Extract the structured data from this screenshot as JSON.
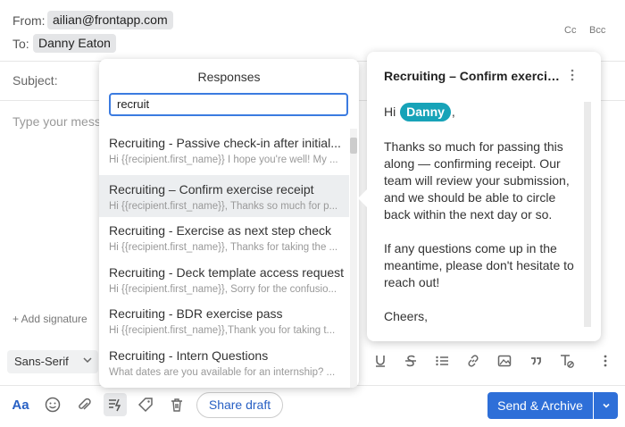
{
  "header": {
    "from_label": "From:",
    "from_value": "ailian@frontapp.com",
    "to_label": "To:",
    "to_value": "Danny Eaton",
    "cc": "Cc",
    "bcc": "Bcc",
    "subject_label": "Subject:",
    "body_placeholder": "Type your message..."
  },
  "add_signature": "+ Add signature",
  "format_bar": {
    "font": "Sans-Serif",
    "icons": [
      "underline-icon",
      "strikethrough-icon",
      "bulleted-list-icon",
      "link-icon",
      "image-icon",
      "quote-icon",
      "clear-formatting-icon",
      "more-vertical-icon"
    ]
  },
  "responses": {
    "title": "Responses",
    "search_value": "recruit",
    "items": [
      {
        "title": "Recruiting - Passive check-in after initial...",
        "snippet": "Hi {{recipient.first_name}} I hope you're well! My ..."
      },
      {
        "title": "Recruiting – Confirm exercise receipt",
        "snippet": "Hi {{recipient.first_name}}, Thanks so much for p...",
        "selected": true
      },
      {
        "title": "Recruiting - Exercise as next step check",
        "snippet": "Hi {{recipient.first_name}}, Thanks for taking the ..."
      },
      {
        "title": "Recruiting - Deck template access request",
        "snippet": "Hi {{recipient.first_name}}, Sorry for the confusio..."
      },
      {
        "title": "Recruiting - BDR exercise pass",
        "snippet": "Hi {{recipient.first_name}},Thank you for taking t..."
      },
      {
        "title": "Recruiting - Intern Questions",
        "snippet": "What dates are you available for an internship? ..."
      }
    ]
  },
  "preview": {
    "title": "Recruiting – Confirm exercise ...",
    "greeting_prefix": "Hi",
    "greeting_name": "Danny",
    "greeting_suffix": ",",
    "paragraph1": "Thanks so much for passing this along — confirming receipt. Our team will review your submission, and we should be able to circle back within the next day or so.",
    "paragraph2": "If any questions come up in the meantime, please don't hesitate to reach out!",
    "closing": "Cheers,"
  },
  "actions": {
    "aa": "Aa",
    "share_draft": "Share draft",
    "send_archive": "Send & Archive"
  },
  "colors": {
    "accent": "#2e6fd8",
    "link": "#2860c4",
    "variable_chip": "#17a3b8"
  }
}
